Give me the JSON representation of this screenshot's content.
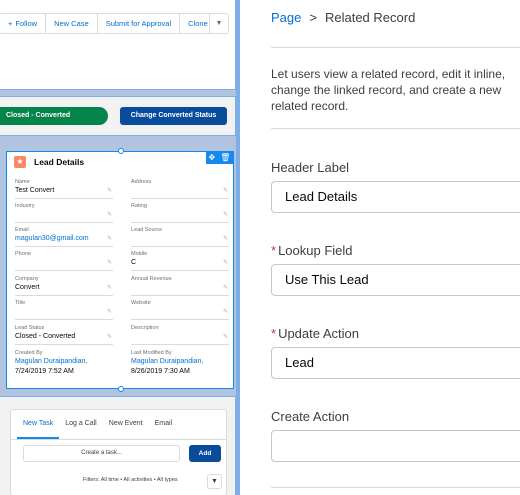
{
  "actions": {
    "follow": "Follow",
    "new_case": "New Case",
    "submit": "Submit for Approval",
    "clone": "Clone"
  },
  "path": {
    "stage": "Closed - Converted",
    "button": "Change Converted Status"
  },
  "lead_card": {
    "title": "Lead Details",
    "fields": {
      "name": {
        "label": "Name",
        "value": "Test Convert"
      },
      "address": {
        "label": "Address",
        "value": ""
      },
      "industry": {
        "label": "Industry",
        "value": ""
      },
      "rating": {
        "label": "Rating",
        "value": ""
      },
      "email": {
        "label": "Email",
        "value": "magulan30@gmail.com"
      },
      "lead_source": {
        "label": "Lead Source",
        "value": ""
      },
      "phone": {
        "label": "Phone",
        "value": ""
      },
      "mobile": {
        "label": "Mobile",
        "value": "C"
      },
      "company": {
        "label": "Company",
        "value": "Convert"
      },
      "annual_revenue": {
        "label": "Annual Revenue",
        "value": ""
      },
      "title": {
        "label": "Title",
        "value": ""
      },
      "website": {
        "label": "Website",
        "value": ""
      },
      "lead_status": {
        "label": "Lead Status",
        "value": "Closed - Converted"
      },
      "description": {
        "label": "Description",
        "value": ""
      },
      "created_by": {
        "label": "Created By",
        "user": "Magulan Duraipandian,",
        "date": "7/24/2019 7:52 AM"
      },
      "modified_by": {
        "label": "Last Modified By",
        "user": "Magulan Duraipandian,",
        "date": "8/26/2019 7:30 AM"
      }
    }
  },
  "activity": {
    "tabs": [
      "New Task",
      "Log a Call",
      "New Event",
      "Email"
    ],
    "task_placeholder": "Create a task...",
    "add_label": "Add",
    "filters": "Filters: All time • All activities • All types"
  },
  "props": {
    "breadcrumb_root": "Page",
    "breadcrumb_sep": ">",
    "breadcrumb_current": "Related Record",
    "description": "Let users view a related record, edit it inline, change the linked record, and create a new related record.",
    "header_label": {
      "label": "Header Label",
      "value": "Lead Details"
    },
    "lookup_field": {
      "label": "Lookup Field",
      "value": "Use This Lead"
    },
    "update_action": {
      "label": "Update Action",
      "value": "Lead"
    },
    "create_action": {
      "label": "Create Action",
      "value": ""
    }
  },
  "colors": {
    "accent": "#0070d2",
    "path_complete": "#04844b",
    "brand_button": "#0a4c9c",
    "lead_icon": "#f88962",
    "required": "#c23934"
  }
}
